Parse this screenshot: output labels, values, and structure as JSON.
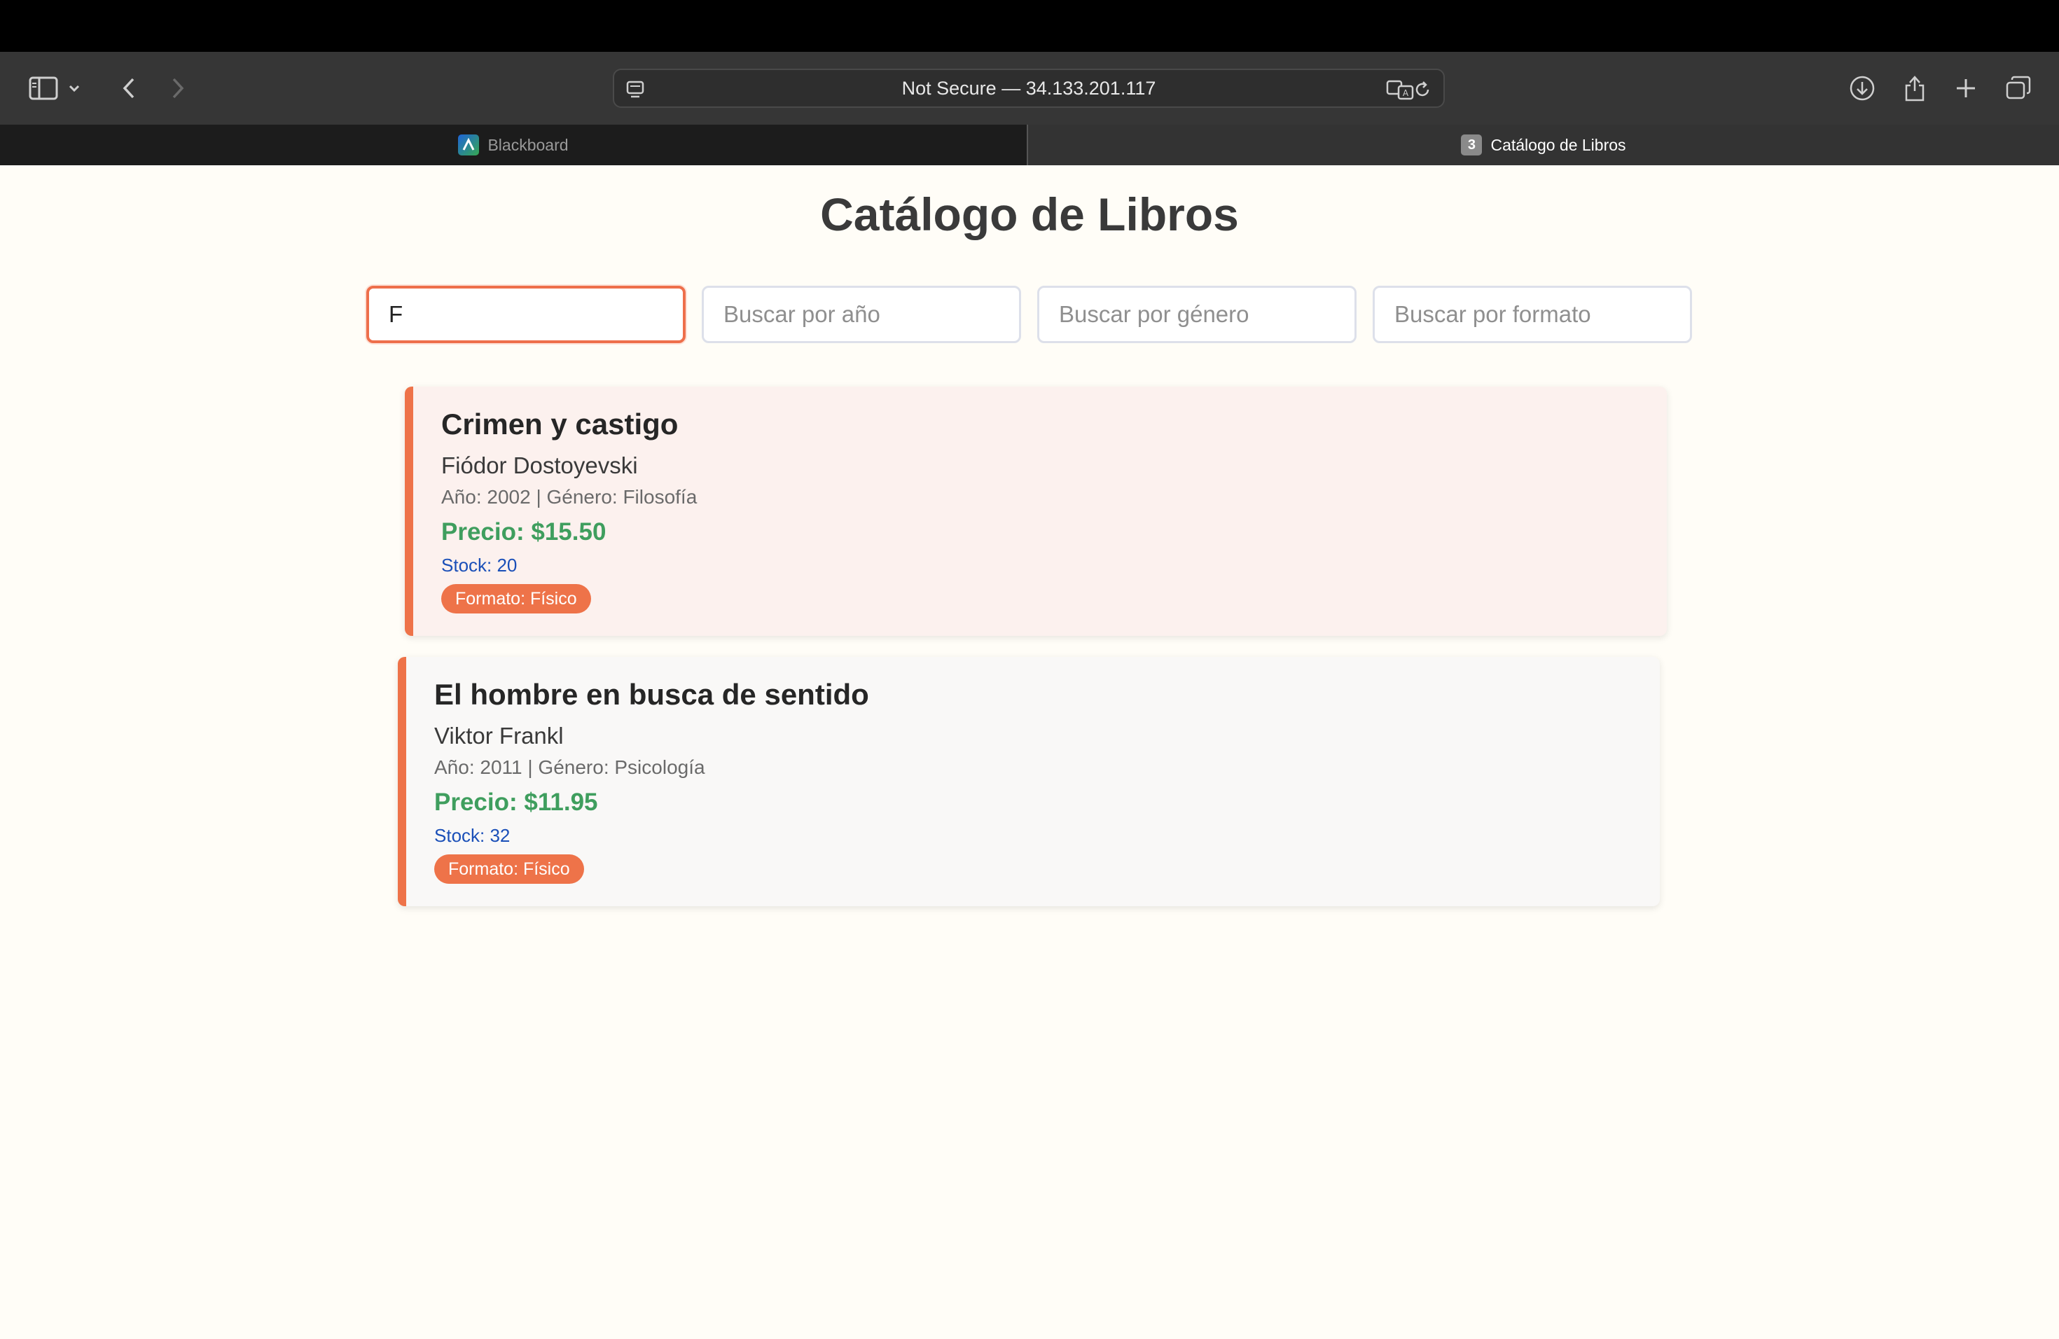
{
  "browser": {
    "url": "Not Secure — 34.133.201.117",
    "tabs": [
      {
        "label": "Blackboard",
        "favicon": "blackboard-logo-icon",
        "active": false
      },
      {
        "label": "Catálogo de Libros",
        "favicon": "3",
        "active": true
      }
    ],
    "icons": [
      "sidebar-icon",
      "chevron-down-icon",
      "back-icon",
      "forward-icon",
      "page-menu-icon",
      "translate-icon",
      "reload-icon",
      "download-icon",
      "share-icon",
      "plus-icon",
      "tabs-overview-icon"
    ]
  },
  "page": {
    "title": "Catálogo de Libros",
    "search": {
      "title": {
        "value": "F",
        "placeholder": ""
      },
      "year": {
        "value": "",
        "placeholder": "Buscar por año"
      },
      "genre": {
        "value": "",
        "placeholder": "Buscar por género"
      },
      "format": {
        "value": "",
        "placeholder": "Buscar por formato"
      }
    },
    "books": [
      {
        "title": "Crimen y castigo",
        "author": "Fiódor Dostoyevski",
        "meta": "Año: 2002 | Género: Filosofía",
        "price": "Precio: $15.50",
        "stock": "Stock: 20",
        "format": "Formato: Físico"
      },
      {
        "title": "El hombre en busca de sentido",
        "author": "Viktor Frankl",
        "meta": "Año: 2011 | Género: Psicología",
        "price": "Precio: $11.95",
        "stock": "Stock: 32",
        "format": "Formato: Físico"
      }
    ]
  },
  "colors": {
    "accent": "#ee7349",
    "price": "#3f9e5e",
    "stock": "#1a4fb8",
    "card1_bg": "#fcf1ee",
    "card2_bg": "#f9f8f7"
  }
}
